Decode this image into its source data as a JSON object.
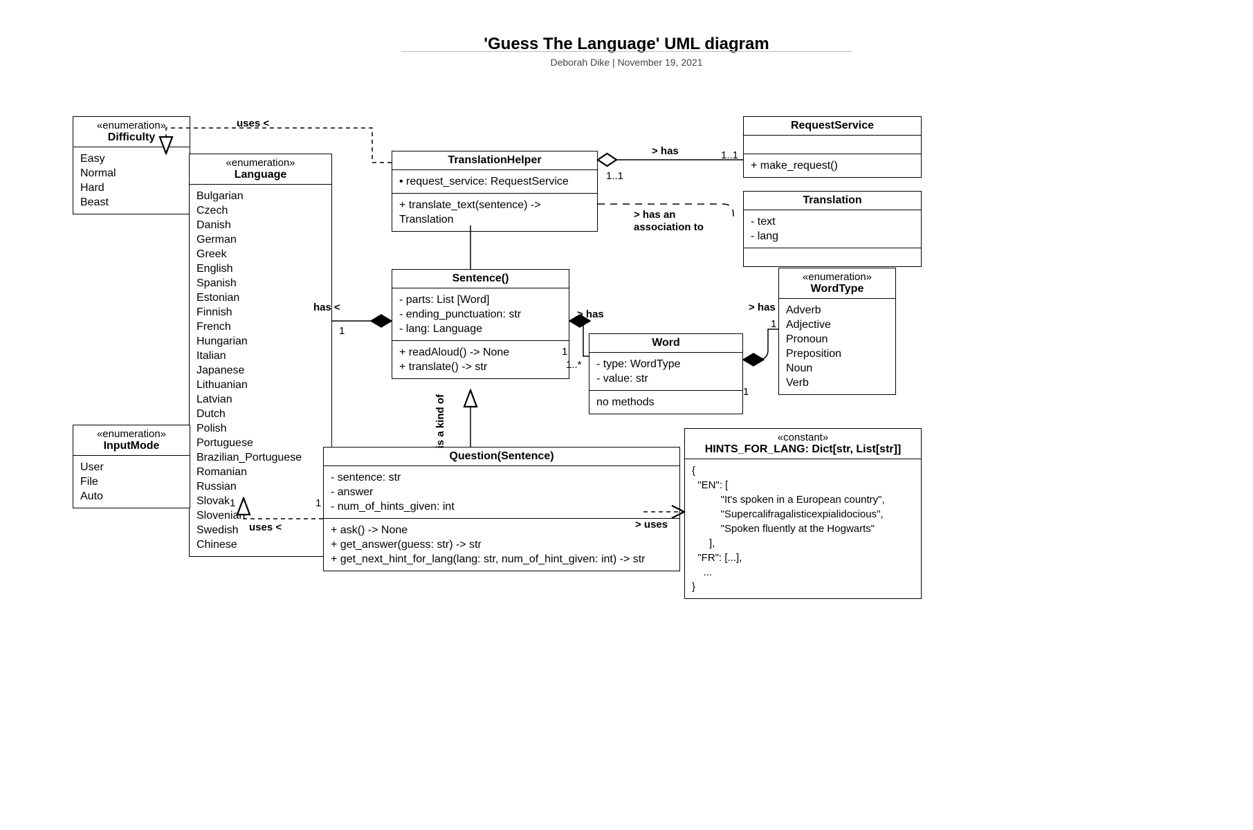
{
  "header": {
    "title": "'Guess The Language' UML diagram",
    "author": "Deborah Dike",
    "date": "November 19, 2021",
    "sep": "  |  "
  },
  "classes": {
    "difficulty": {
      "stereo": "«enumeration»",
      "name": "Difficulty",
      "values": [
        "Easy",
        "Normal",
        "Hard",
        "Beast"
      ]
    },
    "language": {
      "stereo": "«enumeration»",
      "name": "Language",
      "values": [
        "Bulgarian",
        "Czech",
        "Danish",
        "German",
        "Greek",
        "English",
        "Spanish",
        "Estonian",
        "Finnish",
        "French",
        "Hungarian",
        "Italian",
        "Japanese",
        "Lithuanian",
        "Latvian",
        "Dutch",
        "Polish",
        "Portuguese",
        "Brazilian_Portuguese",
        "Romanian",
        "Russian",
        "Slovak",
        "Slovenian",
        "Swedish",
        "Chinese"
      ]
    },
    "inputmode": {
      "stereo": "«enumeration»",
      "name": "InputMode",
      "values": [
        "User",
        "File",
        "Auto"
      ]
    },
    "translationhelper": {
      "name": "TranslationHelper",
      "attrs": [
        "• request_service: RequestService"
      ],
      "methods": [
        "+ translate_text(sentence) -> Translation"
      ]
    },
    "requestservice": {
      "name": "RequestService",
      "methods": [
        "+ make_request()"
      ]
    },
    "translation": {
      "name": "Translation",
      "attrs": [
        "- text",
        "- lang"
      ]
    },
    "sentence": {
      "name": "Sentence()",
      "attrs": [
        "- parts: List [Word]",
        "- ending_punctuation: str",
        "- lang: Language"
      ],
      "methods": [
        "+ readAloud() -> None",
        "+ translate() -> str"
      ]
    },
    "word": {
      "name": "Word",
      "attrs": [
        "- type: WordType",
        "- value: str"
      ],
      "methods": [
        "no methods"
      ]
    },
    "wordtype": {
      "stereo": "«enumeration»",
      "name": "WordType",
      "values": [
        "Adverb",
        "Adjective",
        "Pronoun",
        "Preposition",
        "Noun",
        "Verb"
      ]
    },
    "question": {
      "name": "Question(Sentence)",
      "attrs": [
        "- sentence: str",
        "- answer",
        "- num_of_hints_given: int"
      ],
      "methods": [
        "+ ask() -> None",
        "+ get_answer(guess: str) -> str",
        "+ get_next_hint_for_lang(lang: str, num_of_hint_given: int) -> str"
      ]
    },
    "hints": {
      "stereo": "«constant»",
      "name": "HINTS_FOR_LANG: Dict[str, List[str]]",
      "body": [
        "{",
        "  \"EN\": [",
        "          \"It's spoken in a European country\",",
        "          \"Supercalifragalisticexpialidocious\",",
        "          \"Spoken fluently at the Hogwarts\"",
        "      ],",
        "  \"FR\": [...],",
        "    ...",
        "}"
      ]
    }
  },
  "labels": {
    "uses_left": "uses <",
    "uses_left2": "uses <",
    "has_left": "has <",
    "has_top": "> has",
    "has_assoc": "> has an",
    "assoc_to": "association to",
    "has_word": "> has",
    "has_wordtype": "> has",
    "is_kind": "is a kind of",
    "uses_right": "> uses"
  },
  "card": {
    "th_rs_left": "1..1",
    "th_rs_right": "1..1",
    "sent_lang_left": "1",
    "sent_lang_right": "1",
    "sent_word_left": "1",
    "sent_word_right": "1..*",
    "word_type_left": "1",
    "word_type_right": "1",
    "quest_lang": "1"
  }
}
